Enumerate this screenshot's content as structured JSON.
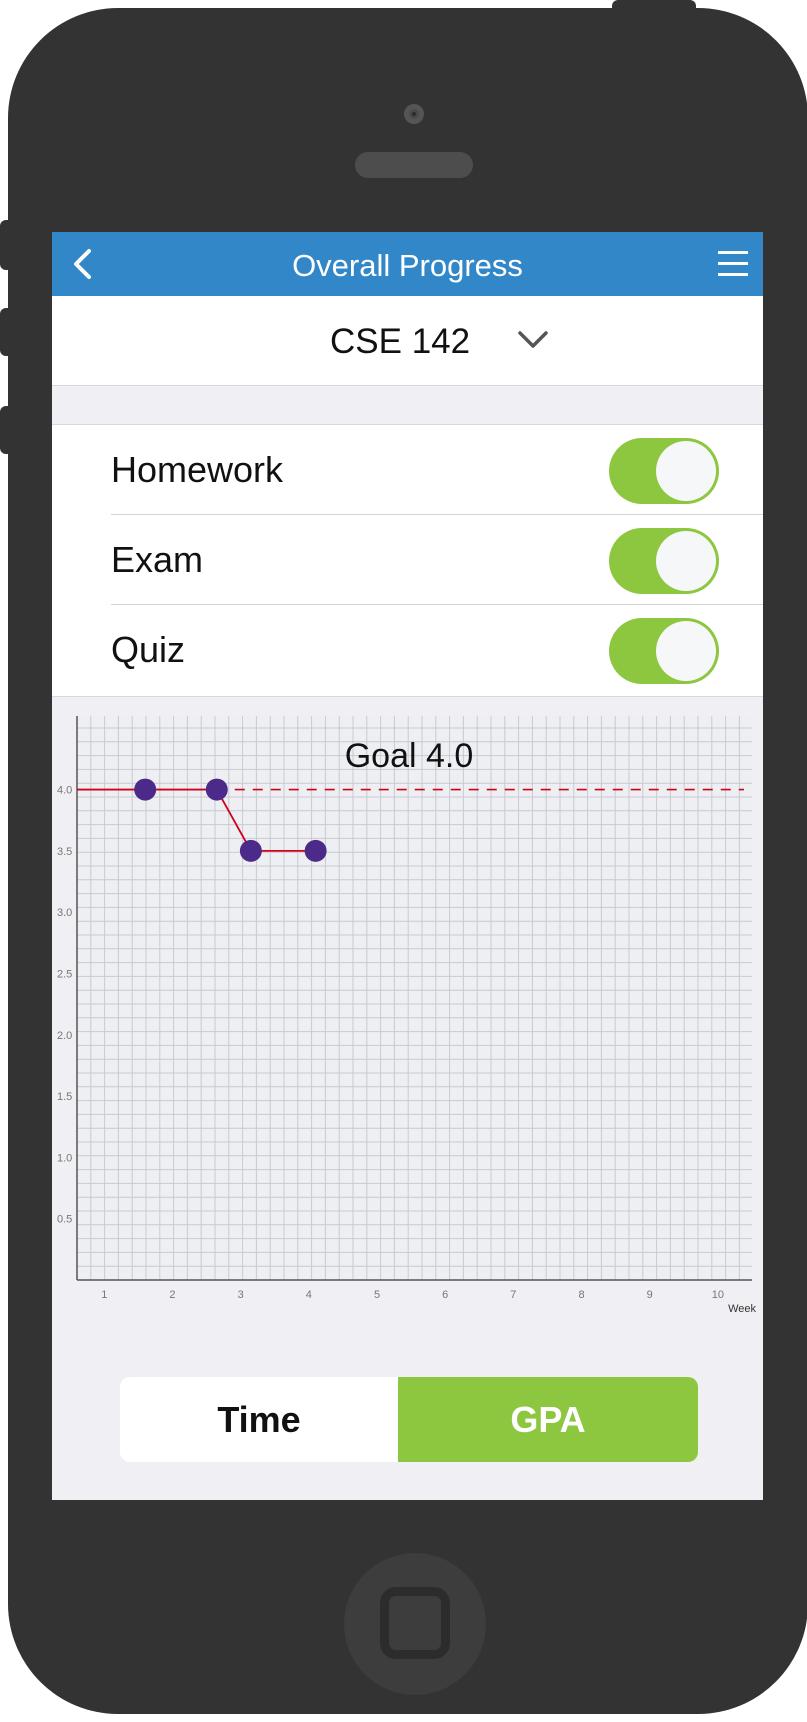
{
  "header": {
    "title": "Overall Progress"
  },
  "course": {
    "selected": "CSE 142"
  },
  "filters": [
    {
      "label": "Homework",
      "on": true
    },
    {
      "label": "Exam",
      "on": true
    },
    {
      "label": "Quiz",
      "on": true
    }
  ],
  "segments": {
    "time_label": "Time",
    "gpa_label": "GPA",
    "selected": "GPA"
  },
  "colors": {
    "header": "#3287c9",
    "accent_green": "#8dc63f",
    "line": "#d0021b",
    "point": "#4b2a8a"
  },
  "icons": {
    "back": "chevron-left-icon",
    "menu": "hamburger-menu-icon",
    "dropdown": "chevron-down-icon"
  },
  "chart_data": {
    "type": "line",
    "title": "",
    "annotation": "Goal 4.0",
    "goal": 4.0,
    "xlabel": "Week",
    "ylabel": "",
    "x_ticks": [
      1,
      2,
      3,
      4,
      5,
      6,
      7,
      8,
      9,
      10
    ],
    "y_ticks": [
      0.5,
      1.0,
      1.5,
      2.0,
      2.5,
      3.0,
      3.5,
      4.0
    ],
    "y_tick_labels": [
      "0.5",
      "1.0",
      "1.5",
      "2.0",
      "2.5",
      "3.0",
      "3.5",
      "4.0"
    ],
    "xlim": [
      0.6,
      10.5
    ],
    "ylim": [
      0,
      4.6
    ],
    "grid": true,
    "series": [
      {
        "x": [
          0.6,
          1.6,
          2.65,
          3.15,
          4.1
        ],
        "y": [
          4.0,
          4.0,
          4.0,
          3.5,
          3.5
        ],
        "markers": [
          false,
          true,
          true,
          true,
          true
        ]
      }
    ]
  }
}
